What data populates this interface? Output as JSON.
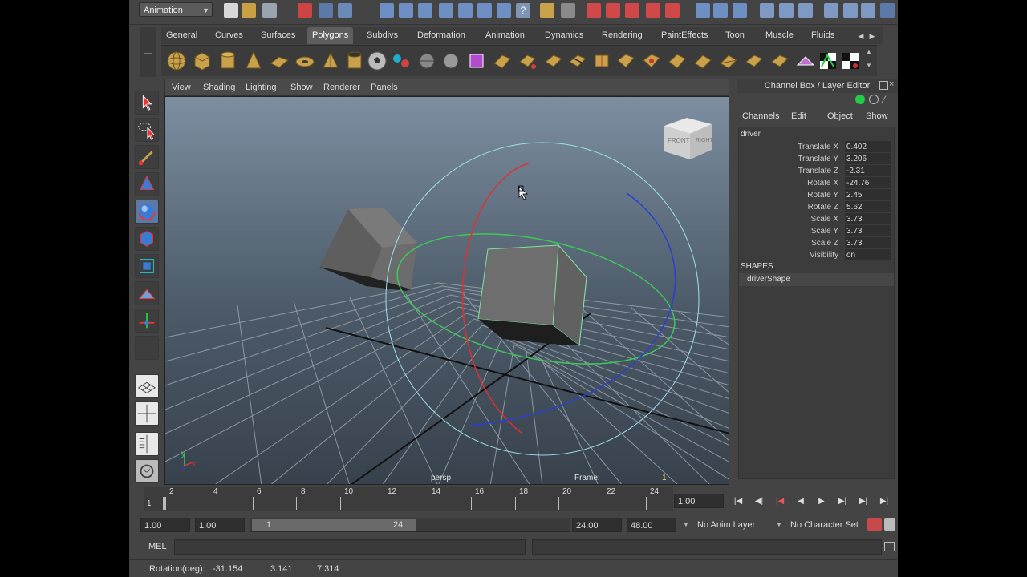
{
  "statusline": {
    "mode": "Animation"
  },
  "shelf": {
    "tabs": [
      "General",
      "Curves",
      "Surfaces",
      "Polygons",
      "Subdivs",
      "Deformation",
      "Animation",
      "Dynamics",
      "Rendering",
      "PaintEffects",
      "Toon",
      "Muscle",
      "Fluids"
    ],
    "active_tab": "Polygons"
  },
  "viewport": {
    "menu": [
      "View",
      "Shading",
      "Lighting",
      "Show",
      "Renderer",
      "Panels"
    ],
    "camera": "persp",
    "frame_label": "Frame:",
    "frame_value": "1",
    "viewcube": {
      "front": "FRONT",
      "right": "RIGHT"
    },
    "axis": {
      "x": "x",
      "y": "y"
    }
  },
  "channelbox": {
    "title": "Channel Box / Layer Editor",
    "menu": [
      "Channels",
      "Edit",
      "Object",
      "Show"
    ],
    "object": "driver",
    "channels": [
      {
        "label": "Translate X",
        "value": "0.402"
      },
      {
        "label": "Translate Y",
        "value": "3.206"
      },
      {
        "label": "Translate Z",
        "value": "-2.31"
      },
      {
        "label": "Rotate X",
        "value": "-24.76"
      },
      {
        "label": "Rotate Y",
        "value": "2.45"
      },
      {
        "label": "Rotate Z",
        "value": "5.62"
      },
      {
        "label": "Scale X",
        "value": "3.73"
      },
      {
        "label": "Scale Y",
        "value": "3.73"
      },
      {
        "label": "Scale Z",
        "value": "3.73"
      },
      {
        "label": "Visibility",
        "value": "on"
      }
    ],
    "shapes_header": "SHAPES",
    "shape_name": "driverShape"
  },
  "timeslider": {
    "start_label": "1",
    "ticks": [
      "2",
      "4",
      "6",
      "8",
      "10",
      "12",
      "14",
      "16",
      "18",
      "20",
      "22",
      "24"
    ],
    "current_time": "1.00"
  },
  "rangebar": {
    "anim_start": "1.00",
    "range_start": "1.00",
    "slider_start": "1",
    "slider_end": "24",
    "range_end": "24.00",
    "anim_end": "48.00",
    "anim_layer": "No Anim Layer",
    "character_set": "No Character Set"
  },
  "cmdline": {
    "label": "MEL"
  },
  "helpline": {
    "label": "Rotation(deg):",
    "x": "-31.154",
    "y": "3.141",
    "z": "7.314"
  },
  "colors": {
    "accent": "#5c7aa8",
    "active_tab": "#5e5e5e"
  }
}
